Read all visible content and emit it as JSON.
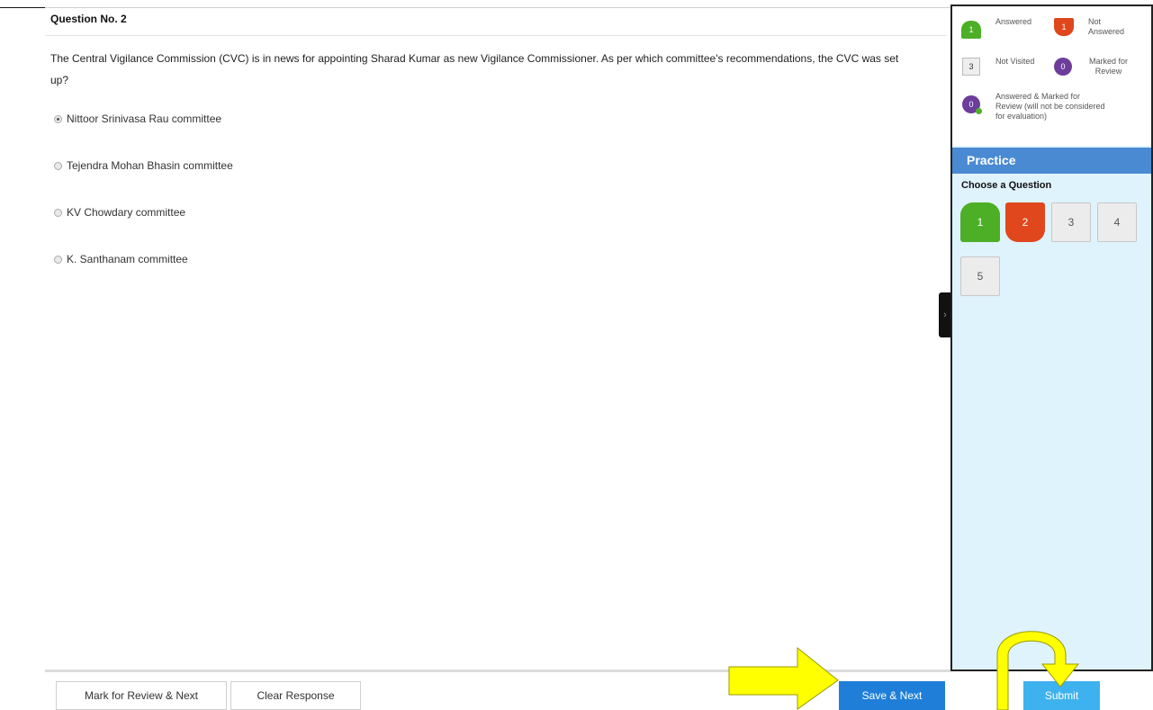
{
  "question": {
    "header": "Question No. 2",
    "text": "The Central Vigilance Commission (CVC) is in news for appointing Sharad Kumar as new Vigilance Commissioner. As per which committee's recommendations, the CVC was set up?",
    "options": [
      {
        "label": "Nittoor Srinivasa Rau committee",
        "selected": true
      },
      {
        "label": "Tejendra Mohan Bhasin committee",
        "selected": false
      },
      {
        "label": "KV Chowdary committee",
        "selected": false
      },
      {
        "label": "K. Santhanam committee",
        "selected": false
      }
    ]
  },
  "footer": {
    "mark_review_label": "Mark for Review & Next",
    "clear_label": "Clear Response",
    "save_next_label": "Save & Next",
    "submit_label": "Submit"
  },
  "legend": {
    "answered": {
      "count": "1",
      "label": "Answered"
    },
    "not_answered": {
      "count": "1",
      "label1": "Not",
      "label2": "Answered"
    },
    "not_visited": {
      "count": "3",
      "label": "Not Visited"
    },
    "marked": {
      "count": "0",
      "label1": "Marked for",
      "label2": "Review"
    },
    "answered_marked": {
      "count": "0",
      "line1": "Answered & Marked for",
      "line2": "Review (will not be considered",
      "line3": "for evaluation)"
    }
  },
  "palette": {
    "section_title": "Practice",
    "choose_label": "Choose a Question",
    "buttons": [
      {
        "number": "1",
        "status": "answered"
      },
      {
        "number": "2",
        "status": "not-answered"
      },
      {
        "number": "3",
        "status": "not-visited"
      },
      {
        "number": "4",
        "status": "not-visited"
      },
      {
        "number": "5",
        "status": "not-visited"
      }
    ]
  },
  "colors": {
    "answered": "#4caf26",
    "not_answered": "#e0471d",
    "marked": "#6c3d9a",
    "save_button": "#1f7fd8",
    "submit_button": "#3eb2ee",
    "practice_header": "#4a8ad2",
    "panel_bg": "#dff3fd",
    "annotation_arrow": "#ffff00"
  }
}
